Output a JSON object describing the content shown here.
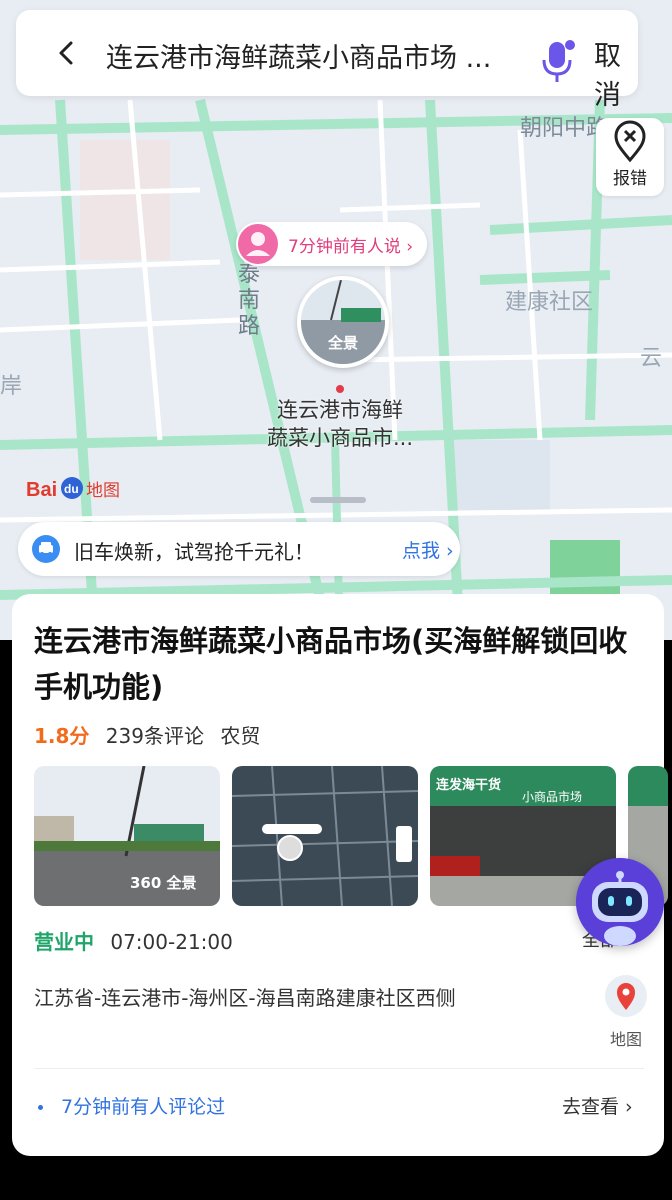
{
  "search": {
    "title": "连云港市海鲜蔬菜小商品市场 ...",
    "cancel_label": "取消"
  },
  "map": {
    "report_label": "报错",
    "labels": {
      "chaoyang": "朝阳中路",
      "jiankang": "建康社区",
      "yun": "云",
      "an": "岸",
      "road_v": "泰南路"
    },
    "bubble_text": "7分钟前有人说 ›",
    "pin_label": "全景",
    "poi_name_line1": "连云港市海鲜",
    "poi_name_line2": "蔬菜小商品市...",
    "logo_text": "Baidu地图"
  },
  "promo": {
    "text": "旧车焕新，试驾抢千元礼！",
    "link": "点我 ›"
  },
  "place": {
    "title": "连云港市海鲜蔬菜小商品市场(买海鲜解锁回收手机功能)",
    "rating": "1.8分",
    "reviews": "239条评论",
    "category": "农贸",
    "photo1_label": "360 全景",
    "photo3_sign": "连发海干货",
    "photo3_sign2": "小商品市场",
    "status": "营业中",
    "hours": "07:00-21:00",
    "all_label": "全部",
    "address": "江苏省-连云港市-海州区-海昌南路建康社区西侧",
    "map_label": "地图",
    "review_note": "7分钟前有人评论过",
    "review_link": "去查看 ›"
  },
  "colors": {
    "accent": "#3173e0",
    "rating": "#f26a1b",
    "open": "#1fa56a",
    "road": "#a9e6c9",
    "bubble": "#e23c7d"
  }
}
